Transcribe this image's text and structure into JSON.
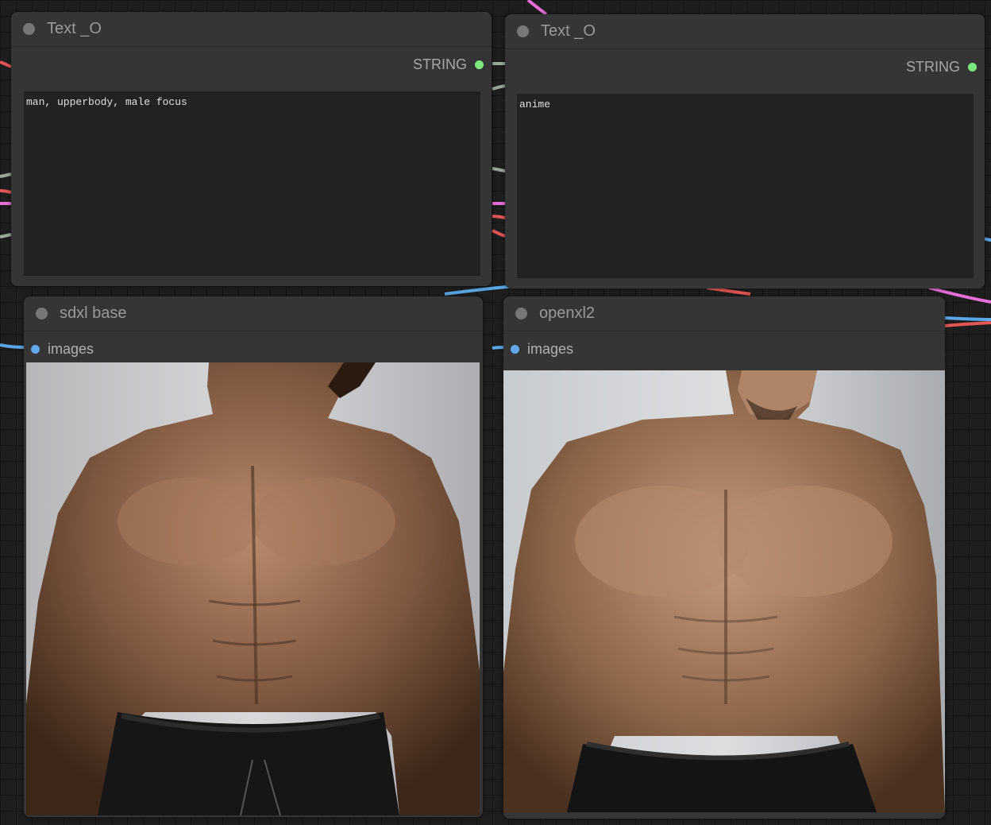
{
  "nodes": {
    "text1": {
      "title": "Text _O",
      "output_label": "STRING",
      "text_value": "man, upperbody, male focus"
    },
    "text2": {
      "title": "Text _O",
      "output_label": "STRING",
      "text_value": "anime"
    },
    "preview1": {
      "title": "sdxl base",
      "input_label": "images"
    },
    "preview2": {
      "title": "openxl2",
      "input_label": "images"
    }
  },
  "colors": {
    "string_slot": "#7de87d",
    "image_slot": "#63a8ec",
    "wire_pink": "#e86fd8",
    "wire_red": "#e25656",
    "wire_blue": "#5aa6e6",
    "wire_gray": "#9aa89a"
  }
}
